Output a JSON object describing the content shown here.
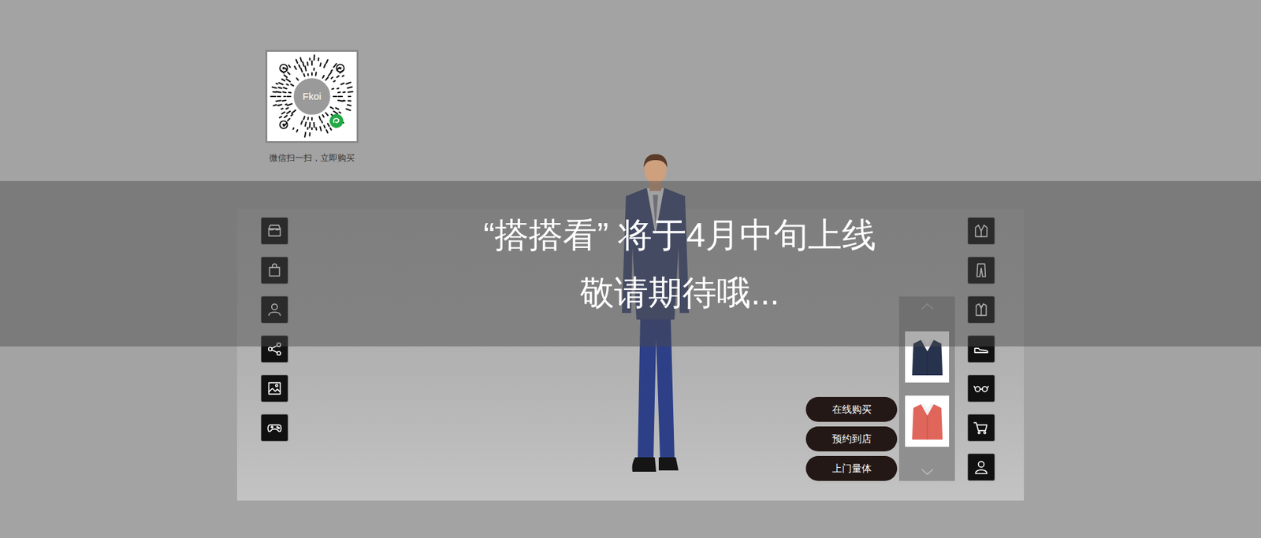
{
  "qr": {
    "logo": "Fkoi",
    "caption": "微信扫一扫，立即购买"
  },
  "notice": {
    "lines": [
      "“搭搭看” 将于4月中旬上线",
      "敬请期待哦..."
    ]
  },
  "actions": [
    "在线购买",
    "预约到店",
    "上门量体"
  ],
  "carousel": {
    "items": [
      {
        "color": "#27324d"
      },
      {
        "color": "#e0655a"
      }
    ]
  }
}
